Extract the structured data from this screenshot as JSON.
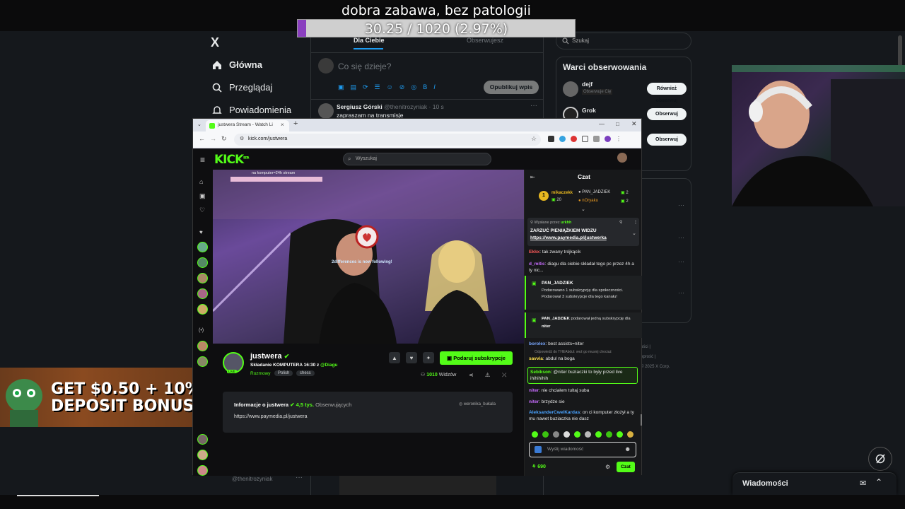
{
  "overlay": {
    "title": "dobra zabawa, bez patologii",
    "goal_text": "30.25 / 1020 (2.97%)",
    "goal_fraction": 0.0297
  },
  "x": {
    "logo": "X",
    "nav": [
      {
        "label": "Główna",
        "icon": "home-icon"
      },
      {
        "label": "Przeglądaj",
        "icon": "search-icon"
      },
      {
        "label": "Powiadomienia",
        "icon": "bell-icon"
      }
    ],
    "tabs": [
      "Dla Ciebie",
      "Obserwujesz"
    ],
    "compose_placeholder": "Co się dzieje?",
    "post_button": "Opublikuj wpis",
    "toolbar_letters": [
      "B",
      "I"
    ],
    "tweet": {
      "author": "Sergiusz Górski",
      "handle": "@thenitrozyniak",
      "time": "· 10 s",
      "text": "zapraszam na transmisje"
    },
    "more": "···",
    "search_placeholder": "Szukaj",
    "who_to_follow_title": "Warci obserwowania",
    "suggestions": [
      {
        "name": "dejf",
        "sub": "Obserwuje Cię",
        "button": "Również obserwuj"
      },
      {
        "name": "Grok",
        "sub": "",
        "button": "Obserwuj"
      },
      {
        "name": "",
        "sub": "",
        "button": "Obserwuj"
      }
    ],
    "footer_bits": [
      "ości |",
      "eprość |",
      "© 2025 X Corp."
    ],
    "bottom_handle": "@thenitrozyniak",
    "messages_title": "Wiadomości"
  },
  "promo": {
    "line1": "GET $0.50 + 10%",
    "line2": "DEPOSIT BONUS"
  },
  "browser": {
    "tab_title": "justwera Stream - Watch Li",
    "new_tab": "+",
    "url": "kick.com/justwera"
  },
  "kick": {
    "logo": "KICK",
    "logo_sup": "BETA",
    "search_placeholder": "Wyszukaj",
    "video_overlay_top": "na komputer=24h stream",
    "video_overlay_follow": "2differences is now following!",
    "channel": {
      "name": "justwera",
      "title": "Składanie KOMPUTERA 16:30 z",
      "title_mention": "@Diagu",
      "category": "Rozmowy",
      "tags": [
        "Polish",
        "chess"
      ],
      "live": "LIVE",
      "subscribe": "Podaruj subskrypcje",
      "viewers": "1010",
      "viewers_label": "Widzów"
    },
    "about": {
      "title": "Informacje o justwera",
      "followers": "4,5 tys.",
      "followers_label": "Obserwujących",
      "link": "https://www.paymedia.pl/justwera",
      "social": "weronika_bukala"
    },
    "chat": {
      "title": "Czat",
      "gifters": [
        {
          "rank": "1",
          "name": "mikaczekk",
          "count": "20"
        },
        {
          "rank": "",
          "name": "PAN_JADZIEK",
          "count": "2"
        },
        {
          "rank": "",
          "name": "nOryaku",
          "count": "2"
        }
      ],
      "pinned": {
        "by_label": "Wysłane przez",
        "by": "urkhh",
        "title": "ZARZUĆ PIENIĄŻKIEM WIDZU",
        "link": "https://www.paymedia.pl/justwerka"
      },
      "messages": [
        {
          "user": "Ekkx",
          "text": "tak zwany trójkącik",
          "color": "#ff5a5a"
        },
        {
          "user": "d_mitic",
          "text": "diagu dla ciebie składał tego pc przez 4h a ty nic...",
          "color": "#c86cff"
        }
      ],
      "sub_events": [
        {
          "user": "PAN_JADZIEK",
          "line1": "Podarowano 1 subskrypcję dla społeczności.",
          "line2": "Podarowal 3 subskrypcje dla tego kanału!"
        },
        {
          "user": "PAN_JADZIEK",
          "line1": "podarował jedną subskrypcję dla",
          "line2": "niter"
        }
      ],
      "messages2": [
        {
          "user": "borolex",
          "text": "best assists=niter",
          "color": "#7aa8ff"
        },
        {
          "user": "",
          "text": "Odpowiedź do THEAbdul: weź go musnij chociaż",
          "color": "#888"
        },
        {
          "user": "savvia",
          "text": "abdul na boga",
          "color": "#ffe14d"
        },
        {
          "user": "Sebikson",
          "text": "@niter buziaczki to były przed live ihihihihih",
          "color": "#53fc18"
        },
        {
          "user": "niter",
          "text": "nie chciałem tultaj suba",
          "color": "#c86cff"
        },
        {
          "user": "niter",
          "text": "brzydze sie",
          "color": "#c86cff"
        },
        {
          "user": "AleksanderCwelKardas",
          "text": "on ci komputer złożył a ty mu nawet buziaczka nie dasz",
          "color": "#4aa3ff"
        }
      ],
      "input_placeholder": "Wyślij wiadomość",
      "points": "690",
      "send": "Czat"
    }
  }
}
